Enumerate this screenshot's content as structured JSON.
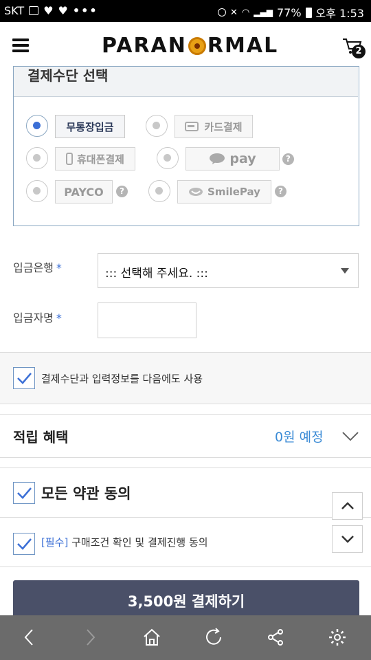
{
  "status_bar": {
    "carrier": "SKT",
    "dots": "•••",
    "battery": "77%",
    "time": "오후 1:53"
  },
  "header": {
    "logo_left": "PARAN",
    "logo_right": "RMAL",
    "cart_count": "2"
  },
  "payment": {
    "title": "결제수단 선택",
    "methods": [
      {
        "label": "무통장입금",
        "selected": true
      },
      {
        "label": "카드결제",
        "selected": false
      },
      {
        "label": "휴대폰결제",
        "selected": false
      },
      {
        "label": "pay",
        "selected": false
      },
      {
        "label": "PAYCO",
        "selected": false
      },
      {
        "label": "SmilePay",
        "selected": false
      }
    ],
    "help": "?"
  },
  "form": {
    "bank_label": "입금은행",
    "bank_placeholder": "::: 선택해 주세요. :::",
    "depositor_label": "입금자명",
    "required_mark": "*",
    "depositor_value": ""
  },
  "save_option": {
    "label": "결제수단과 입력정보를 다음에도 사용",
    "checked": true
  },
  "reward": {
    "title": "적립 혜택",
    "value": "0원 예정"
  },
  "agreements": {
    "all_label": "모든 약관 동의",
    "required_tag": "[필수]",
    "required_label": "구매조건 확인 및 결제진행 동의"
  },
  "pay_button": "3,500원 결제하기",
  "colors": {
    "accent": "#3b6fd6",
    "pay_button": "#4a5068",
    "nav_bar": "#6b6b6b",
    "reward_value": "#3b8bd6"
  }
}
